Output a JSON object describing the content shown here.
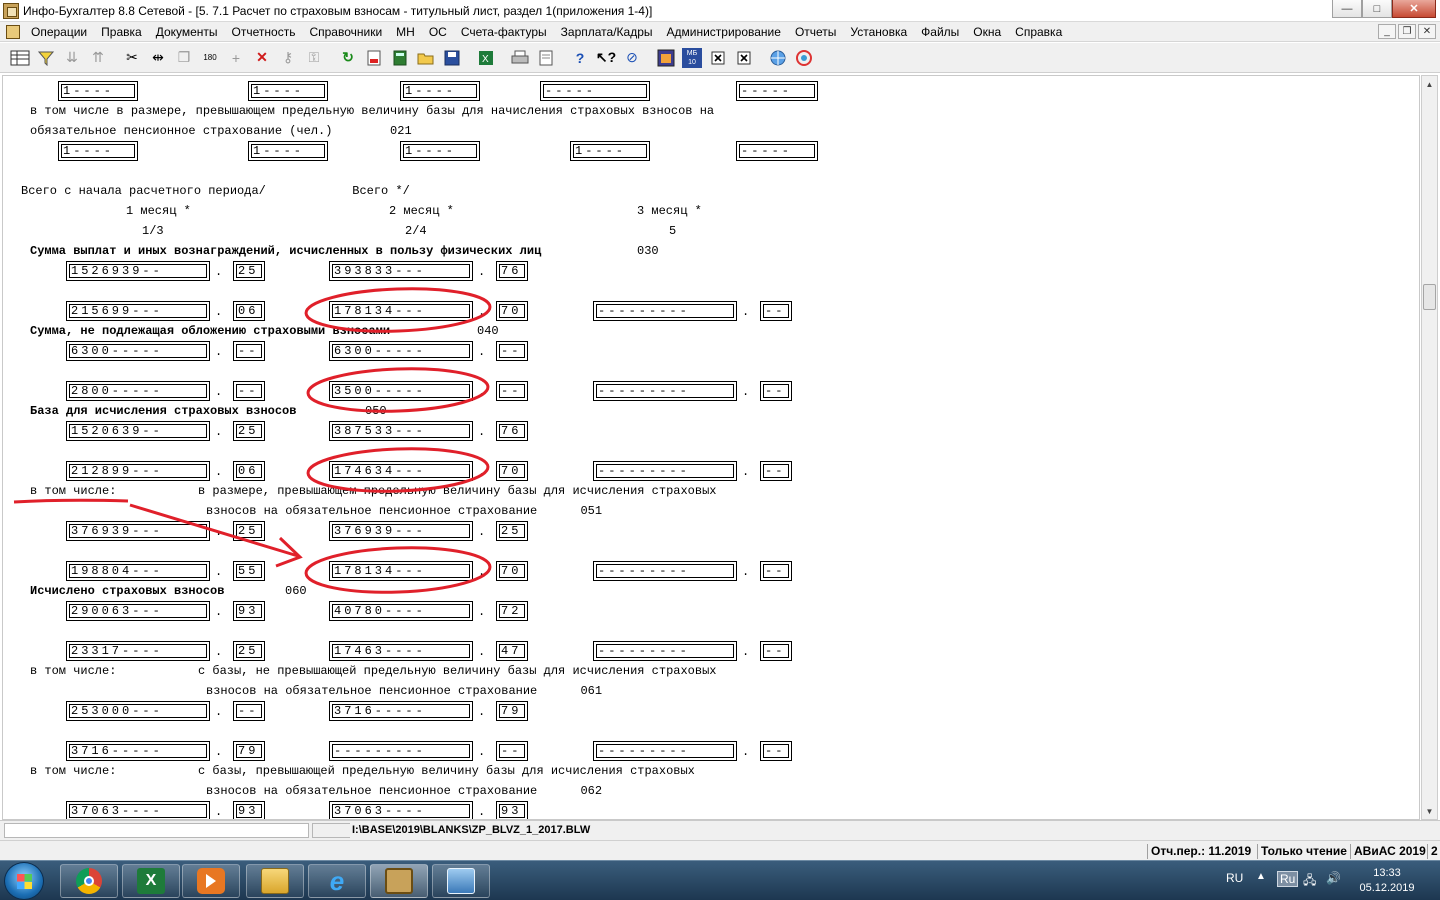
{
  "window": {
    "title": "Инфо-Бухгалтер 8.8 Сетевой - [5.  7.1 Расчет по страховым взносам - титульный лист, раздел 1(приложения 1-4)]",
    "buttons": [
      "—",
      "□",
      "✕"
    ]
  },
  "menu": [
    "Операции",
    "Правка",
    "Документы",
    "Отчетность",
    "Справочники",
    "МН",
    "ОС",
    "Счета-фактуры",
    "Зарплата/Кадры",
    "Администрирование",
    "Отчеты",
    "Установка",
    "Файлы",
    "Окна",
    "Справка"
  ],
  "mdi_buttons": [
    "_",
    "❐",
    "✕"
  ],
  "toolbar": {
    "icons": [
      "grid-icon",
      "filter-icon",
      "sort-desc-icon",
      "sort-asc-icon",
      "cut-icon",
      "split-icon",
      "copy-icon",
      "rotate-180-icon",
      "add-icon",
      "delete-icon",
      "key-icon",
      "lock-icon",
      "refresh-icon",
      "pdf-icon",
      "calculator-icon",
      "folder-open-icon",
      "save-icon",
      "excel-icon",
      "print-icon",
      "page-icon",
      "help-icon",
      "context-help-icon",
      "compass-icon",
      "app-window-icon",
      "mb-icon",
      "close-box-icon",
      "close-box-2-icon",
      "globe-icon",
      "network-icon"
    ],
    "labels": {
      "rotate": "180",
      "mb": "МБ 10"
    }
  },
  "texts": [
    "в том числе в размере, превышающем предельную величину базы для начисления страховых взносов на",
    "обязательное пенсионное страхование (чел.)        021",
    "Всего с начала расчетного периода/            Всего */",
    "1 месяц *",
    "2 месяц *",
    "3 месяц *",
    "1/3",
    "2/4",
    "5",
    "Сумма выплат и иных вознаграждений, исчисленных в пользу физических лиц",
    "030",
    "Сумма, не подлежащая обложению страховыми взносами",
    "040",
    "База для исчисления страховых взносов",
    "050",
    "в том числе:",
    "в размере, превышающем предельную величину базы для исчисления страховых",
    "взносов на обязательное пенсионное страхование      051",
    "Исчислено страховых взносов",
    "060",
    "в том числе:",
    "с базы, не превышающей предельную величину базы для исчисления страховых",
    "взносов на обязательное пенсионное страхование      061",
    "в том числе:",
    "с базы, превышающей предельную величину базы для исчисления страховых",
    "взносов на обязательное пенсионное страхование      062"
  ],
  "cells": [
    "1----",
    "1----",
    "1----",
    "-----",
    "-----",
    "1----",
    "1----",
    "1----",
    "1----",
    "-----",
    "1526939--",
    "25",
    "393833---",
    "76",
    "215699---",
    "06",
    "178134---",
    "70",
    "---------",
    "--",
    "6300-----",
    "--",
    "6300-----",
    "--",
    "2800-----",
    "--",
    "3500-----",
    "--",
    "---------",
    "--",
    "1520639--",
    "25",
    "387533---",
    "76",
    "212899---",
    "06",
    "174634---",
    "70",
    "---------",
    "--",
    "376939---",
    "25",
    "376939---",
    "25",
    "198804---",
    "55",
    "178134---",
    "70",
    "---------",
    "--",
    "290063---",
    "93",
    "40780----",
    "72",
    "23317----",
    "25",
    "17463----",
    "47",
    "---------",
    "--",
    "253000---",
    "--",
    "3716-----",
    "79",
    "3716-----",
    "79",
    "---------",
    "--",
    "---------",
    "--",
    "37063----",
    "93",
    "37063----",
    "93"
  ],
  "path_bar": {
    "path": "I:\\BASE\\2019\\BLANKS\\ZP_BLVZ_1_2017.BLW"
  },
  "status_bar": {
    "period": "Отч.пер.: 11.2019",
    "mode": "Только чтение",
    "vendor": "АВиАС 2019",
    "extra": "2"
  },
  "taskbar": {
    "apps": [
      "chrome-icon",
      "excel-icon",
      "media-player-icon",
      "file-explorer-icon",
      "ie-icon",
      "info-accountant-icon",
      "window-app-icon"
    ],
    "lang": "RU",
    "lang_badge": "Ru",
    "time": "13:33",
    "date": "05.12.2019"
  },
  "colors": {
    "annotation": "#e0202a"
  }
}
